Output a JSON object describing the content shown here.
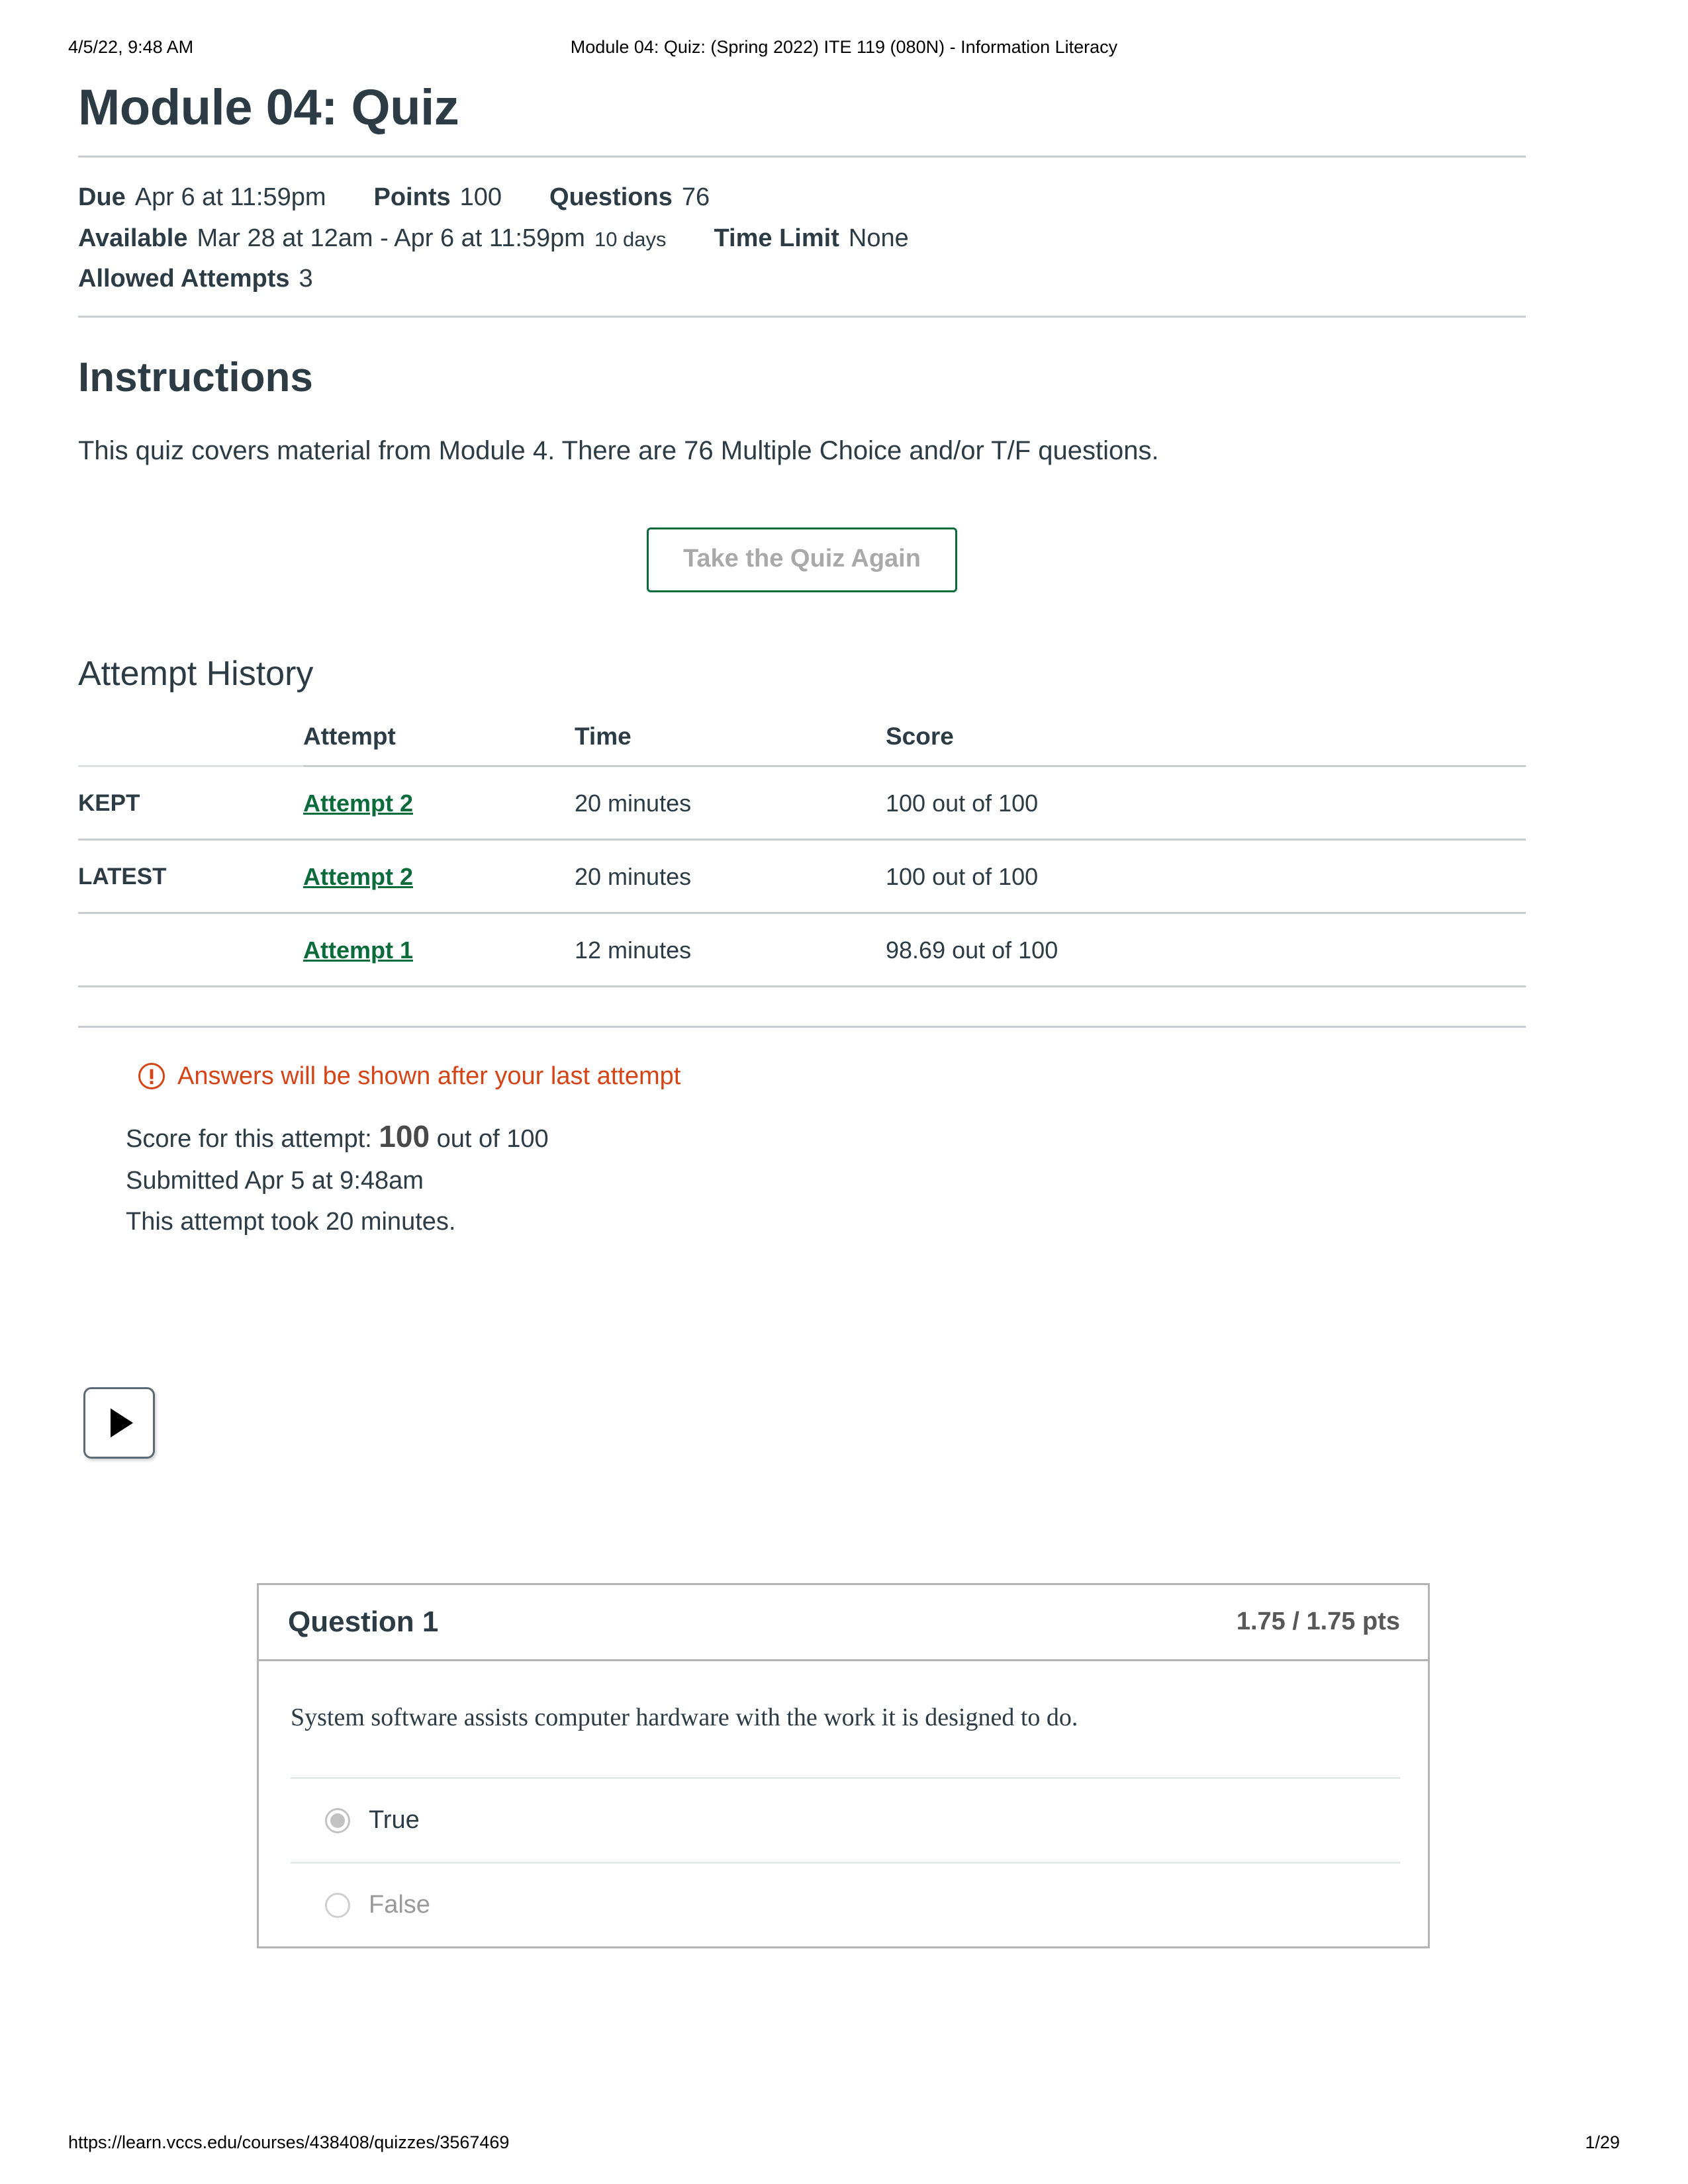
{
  "print_header": {
    "date": "4/5/22, 9:48 AM",
    "title": "Module 04: Quiz: (Spring 2022) ITE 119 (080N) - Information Literacy"
  },
  "print_footer": {
    "url": "https://learn.vccs.edu/courses/438408/quizzes/3567469",
    "page": "1/29"
  },
  "page_title": "Module 04: Quiz",
  "meta": {
    "due_label": "Due",
    "due_value": "Apr 6 at 11:59pm",
    "points_label": "Points",
    "points_value": "100",
    "questions_label": "Questions",
    "questions_value": "76",
    "available_label": "Available",
    "available_value": "Mar 28 at 12am - Apr 6 at 11:59pm",
    "available_duration": "10 days",
    "time_limit_label": "Time Limit",
    "time_limit_value": "None",
    "allowed_attempts_label": "Allowed Attempts",
    "allowed_attempts_value": "3"
  },
  "instructions": {
    "heading": "Instructions",
    "body": "This quiz covers material from Module 4. There are 76 Multiple Choice and/or T/F questions."
  },
  "take_again_button": "Take the Quiz Again",
  "attempt_history": {
    "heading": "Attempt History",
    "columns": [
      "",
      "Attempt",
      "Time",
      "Score"
    ],
    "rows": [
      {
        "kind": "KEPT",
        "attempt": "Attempt 2",
        "time": "20 minutes",
        "score": "100 out of 100"
      },
      {
        "kind": "LATEST",
        "attempt": "Attempt 2",
        "time": "20 minutes",
        "score": "100 out of 100"
      },
      {
        "kind": "",
        "attempt": "Attempt 1",
        "time": "12 minutes",
        "score": "98.69 out of 100"
      }
    ]
  },
  "alert": {
    "icon": "warning-icon",
    "message": "Answers will be shown after your last attempt"
  },
  "score_summary": {
    "score_prefix": "Score for this attempt:",
    "score_value": "100",
    "score_suffix": "out of 100",
    "submitted": "Submitted Apr 5 at 9:48am",
    "duration": "This attempt took 20 minutes."
  },
  "question": {
    "name": "Question 1",
    "points": "1.75 / 1.75 pts",
    "text": "System software assists computer hardware with the work it is designed to do.",
    "answers": [
      {
        "label": "True",
        "selected": true
      },
      {
        "label": "False",
        "selected": false
      }
    ]
  },
  "colors": {
    "link_green": "#0b6b3a",
    "alert_orange": "#d44416",
    "text": "#2d3b45",
    "rule": "#c7cdd1",
    "card_border": "#b4b4b4"
  }
}
